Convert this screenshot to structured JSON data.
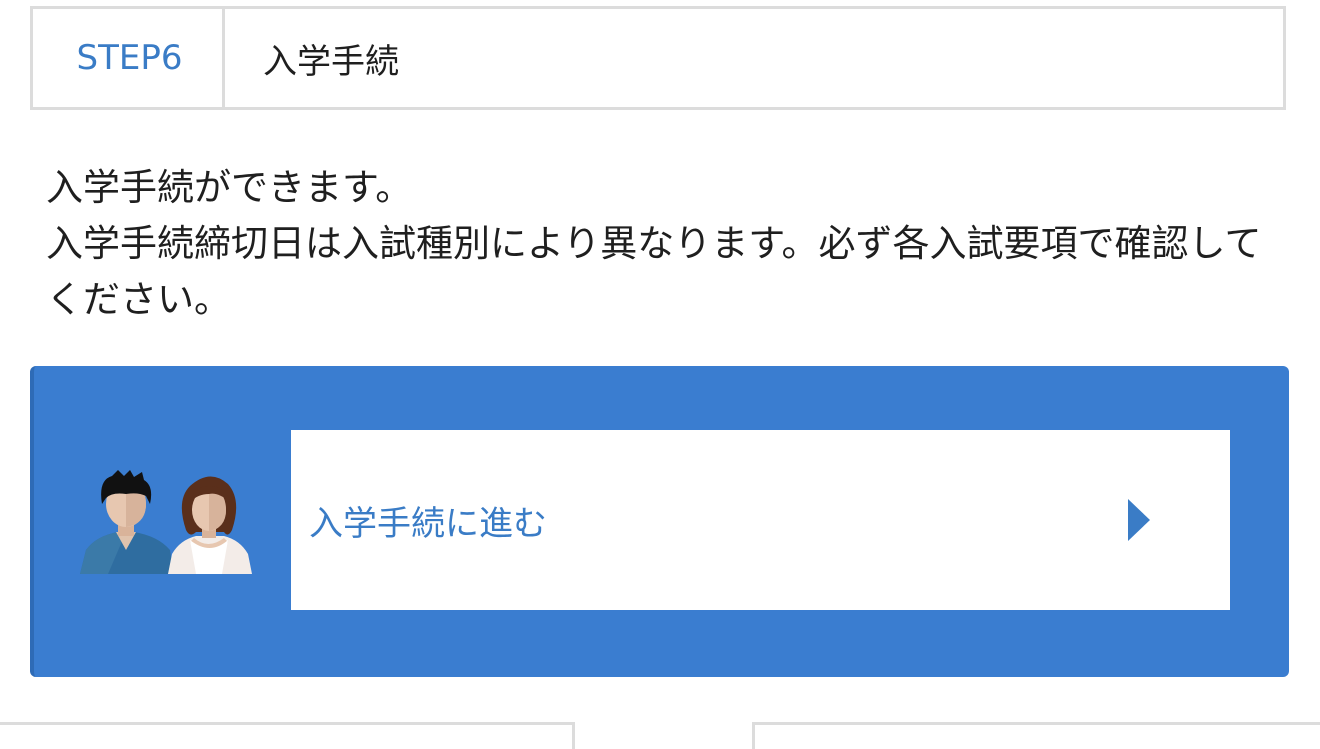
{
  "step": {
    "number_label": "STEP6",
    "title": "入学手続"
  },
  "description": {
    "line1": "入学手続ができます。",
    "line2": "入学手続締切日は入試種別により異なります。必ず各入試要項で確認してください。"
  },
  "action": {
    "label": "入学手続に進む",
    "avatar_icon": "students-pair-icon",
    "arrow_icon": "play-arrow-icon"
  },
  "colors": {
    "accent": "#3a7cc6",
    "panel": "#3a7dd0",
    "border": "#dcdcdc",
    "text": "#1f1f1f"
  }
}
